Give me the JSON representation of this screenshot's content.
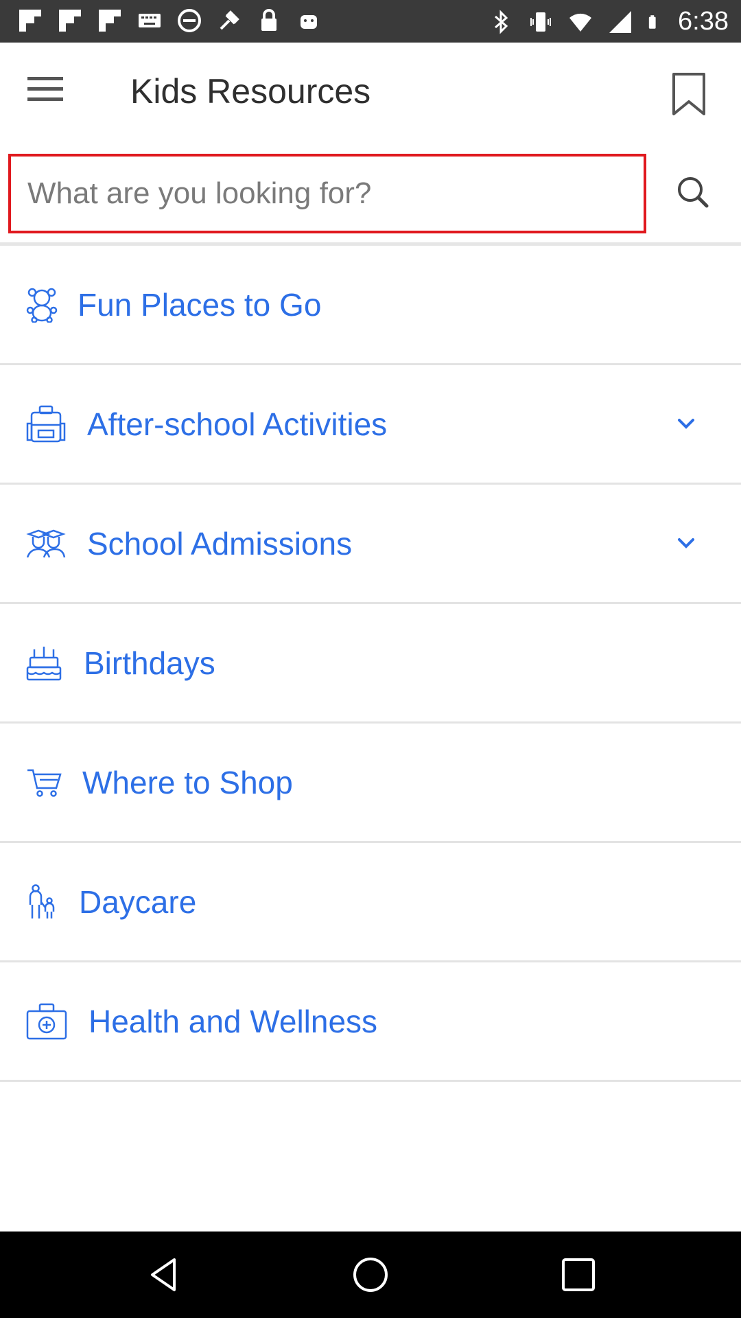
{
  "status_bar": {
    "time": "6:38",
    "icons_left": [
      "flipboard-icon",
      "flipboard-icon",
      "flipboard-icon",
      "keyboard-icon",
      "no-entry-icon",
      "fake-gps-icon",
      "lock-icon",
      "android-icon"
    ],
    "icons_right": [
      "bluetooth-icon",
      "vibrate-icon",
      "wifi-icon",
      "signal-icon",
      "battery-icon"
    ]
  },
  "app_bar": {
    "title": "Kids Resources",
    "menu_icon": "hamburger-menu-icon",
    "bookmark_icon": "bookmark-icon"
  },
  "search": {
    "placeholder": "What are you looking for?",
    "value": "",
    "icon": "search-icon"
  },
  "items": [
    {
      "label": "Fun Places to Go",
      "icon": "teddy-bear-icon",
      "expandable": false
    },
    {
      "label": "After-school Activities",
      "icon": "backpack-icon",
      "expandable": true
    },
    {
      "label": "School Admissions",
      "icon": "graduates-icon",
      "expandable": true
    },
    {
      "label": "Birthdays",
      "icon": "birthday-cake-icon",
      "expandable": false
    },
    {
      "label": "Where to Shop",
      "icon": "shopping-cart-icon",
      "expandable": false
    },
    {
      "label": "Daycare",
      "icon": "parent-child-icon",
      "expandable": false
    },
    {
      "label": "Health and Wellness",
      "icon": "first-aid-kit-icon",
      "expandable": false
    }
  ],
  "colors": {
    "accent": "#2d6fe6",
    "highlight_border": "#e0191e",
    "status_bar": "#3a3a3a",
    "nav_bar": "#000000"
  },
  "nav_bar": [
    "back-icon",
    "home-icon",
    "recents-icon"
  ]
}
